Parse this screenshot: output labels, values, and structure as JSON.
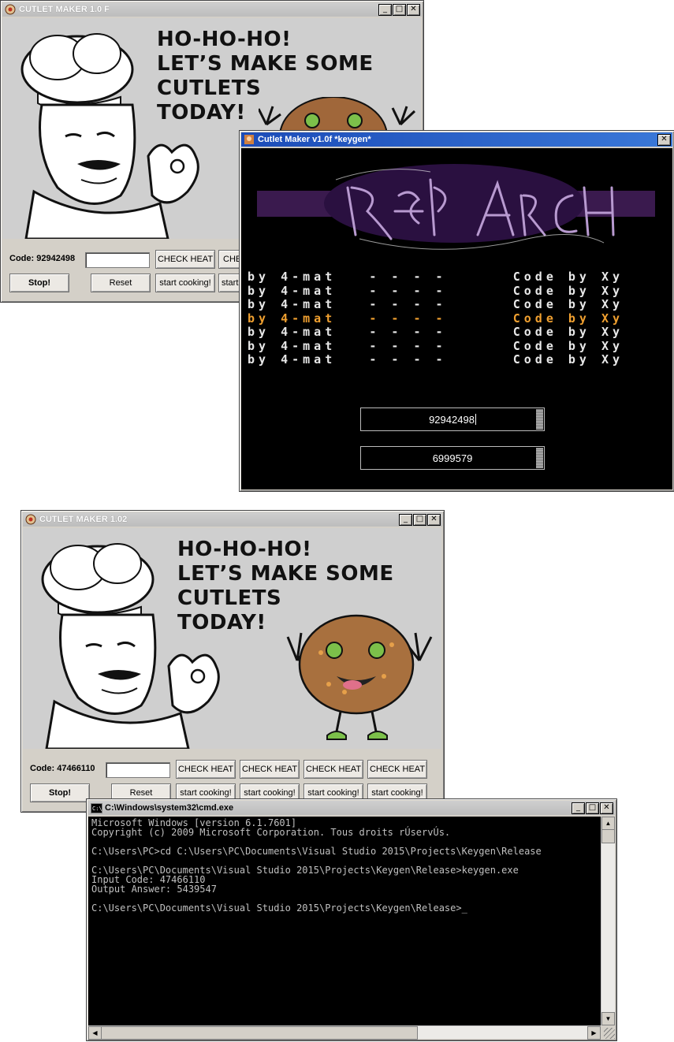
{
  "window1": {
    "title": "CUTLET MAKER 1.0 F",
    "headline": [
      "HO-HO-HO!",
      "LET’S MAKE SOME",
      "CUTLETS",
      "TODAY!"
    ],
    "code_label": "Code: 92942498",
    "check_heat": "CHECK HEAT",
    "check_heat_partial": "CHE",
    "stop": "Stop!",
    "reset": "Reset",
    "start_cooking": "start cooking!",
    "start_partial": "start"
  },
  "keygen": {
    "title": "Cutlet Maker v1.0f *keygen*",
    "logo_text": "REP ARCH",
    "scroller_left": "by 4-mat",
    "scroller_dashes": "- - - -",
    "scroller_right": "Code by Xy",
    "input_code": "92942498",
    "output_code": "6999579",
    "highlight_color": "#f0a030"
  },
  "window2": {
    "title": "CUTLET MAKER 1.02",
    "headline": [
      "HO-HO-HO!",
      "LET’S MAKE SOME",
      "CUTLETS",
      "TODAY!"
    ],
    "code_label": "Code: 47466110",
    "check_heat": "CHECK HEAT",
    "stop": "Stop!",
    "reset": "Reset",
    "start_cooking": "start cooking!"
  },
  "cmd": {
    "title": "C:\\Windows\\system32\\cmd.exe",
    "lines": [
      "Microsoft Windows [version 6.1.7601]",
      "Copyright (c) 2009 Microsoft Corporation. Tous droits rÚservÚs.",
      "",
      "C:\\Users\\PC>cd C:\\Users\\PC\\Documents\\Visual Studio 2015\\Projects\\Keygen\\Release",
      "",
      "C:\\Users\\PC\\Documents\\Visual Studio 2015\\Projects\\Keygen\\Release>keygen.exe",
      "Input Code: 47466110",
      "Output Answer: 5439547",
      "",
      "C:\\Users\\PC\\Documents\\Visual Studio 2015\\Projects\\Keygen\\Release>_"
    ]
  }
}
